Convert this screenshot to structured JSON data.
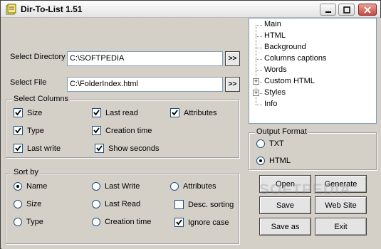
{
  "window": {
    "title": "Dir-To-List 1.51"
  },
  "inputs": {
    "directory_label": "Select Directory",
    "directory_value": "C:\\SOFTPEDIA",
    "file_label": "Select File",
    "file_value": "C:\\FolderIndex.html",
    "browse_label": ">>"
  },
  "columns": {
    "title": "Select Columns",
    "items": [
      {
        "label": "Size",
        "checked": true
      },
      {
        "label": "Last read",
        "checked": true
      },
      {
        "label": "Attributes",
        "checked": true
      },
      {
        "label": "Type",
        "checked": true
      },
      {
        "label": "Creation time",
        "checked": true
      },
      {
        "label": "Last write",
        "checked": true
      },
      {
        "label": "Show seconds",
        "checked": true
      }
    ]
  },
  "sort": {
    "title": "Sort by",
    "radios": [
      "Name",
      "Last Write",
      "Attributes",
      "Size",
      "Last Read",
      "Type",
      "Creation time"
    ],
    "selected": "Name",
    "desc_label": "Desc. sorting",
    "desc_checked": false,
    "ignore_label": "Ignore case",
    "ignore_checked": true
  },
  "tree": {
    "items": [
      {
        "label": "Main",
        "expandable": false
      },
      {
        "label": "HTML",
        "expandable": false
      },
      {
        "label": "Background",
        "expandable": false
      },
      {
        "label": "Columns captions",
        "expandable": false
      },
      {
        "label": "Words",
        "expandable": false
      },
      {
        "label": "Custom HTML",
        "expandable": true
      },
      {
        "label": "Styles",
        "expandable": true
      },
      {
        "label": "Info",
        "expandable": false
      }
    ]
  },
  "output": {
    "title": "Output Format",
    "options": [
      "TXT",
      "HTML"
    ],
    "selected": "HTML"
  },
  "buttons": {
    "open": "Open",
    "generate": "Generate",
    "save": "Save",
    "website": "Web Site",
    "saveas": "Save as",
    "exit": "Exit"
  },
  "watermark": "SOFTPEDIA"
}
